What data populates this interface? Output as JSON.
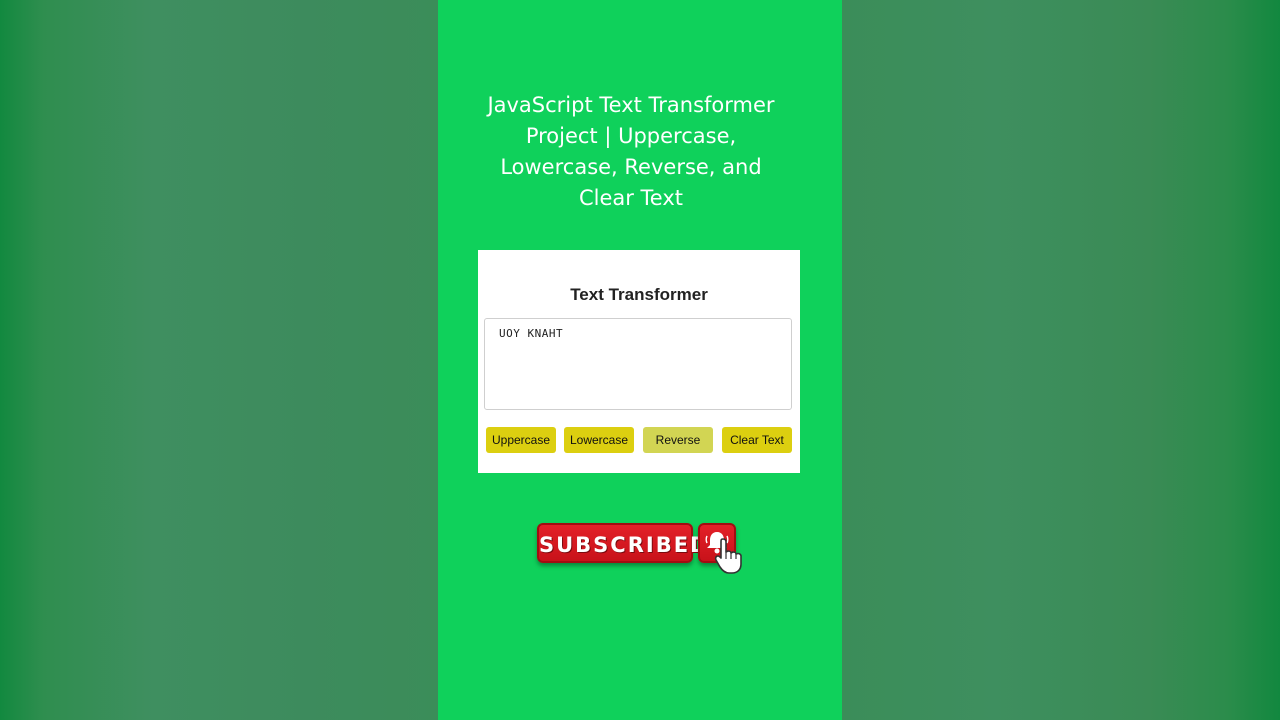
{
  "video": {
    "title": "JavaScript Text Transformer Project | Uppercase, Lowercase, Reverse, and Clear Text"
  },
  "app": {
    "heading": "Text Transformer",
    "textarea_value": "UOY KNAHT",
    "buttons": {
      "uppercase": "Uppercase",
      "lowercase": "Lowercase",
      "reverse": "Reverse",
      "clear": "Clear Text"
    }
  },
  "subscribe": {
    "label": "SUBSCRIBED",
    "bell_icon": "bell-icon",
    "cursor_icon": "hand-pointer-icon"
  },
  "colors": {
    "panel_green": "#0fd15b",
    "button_yellow": "#dccf10",
    "button_active": "#d2d553",
    "subscribe_red": "#d9191f"
  }
}
